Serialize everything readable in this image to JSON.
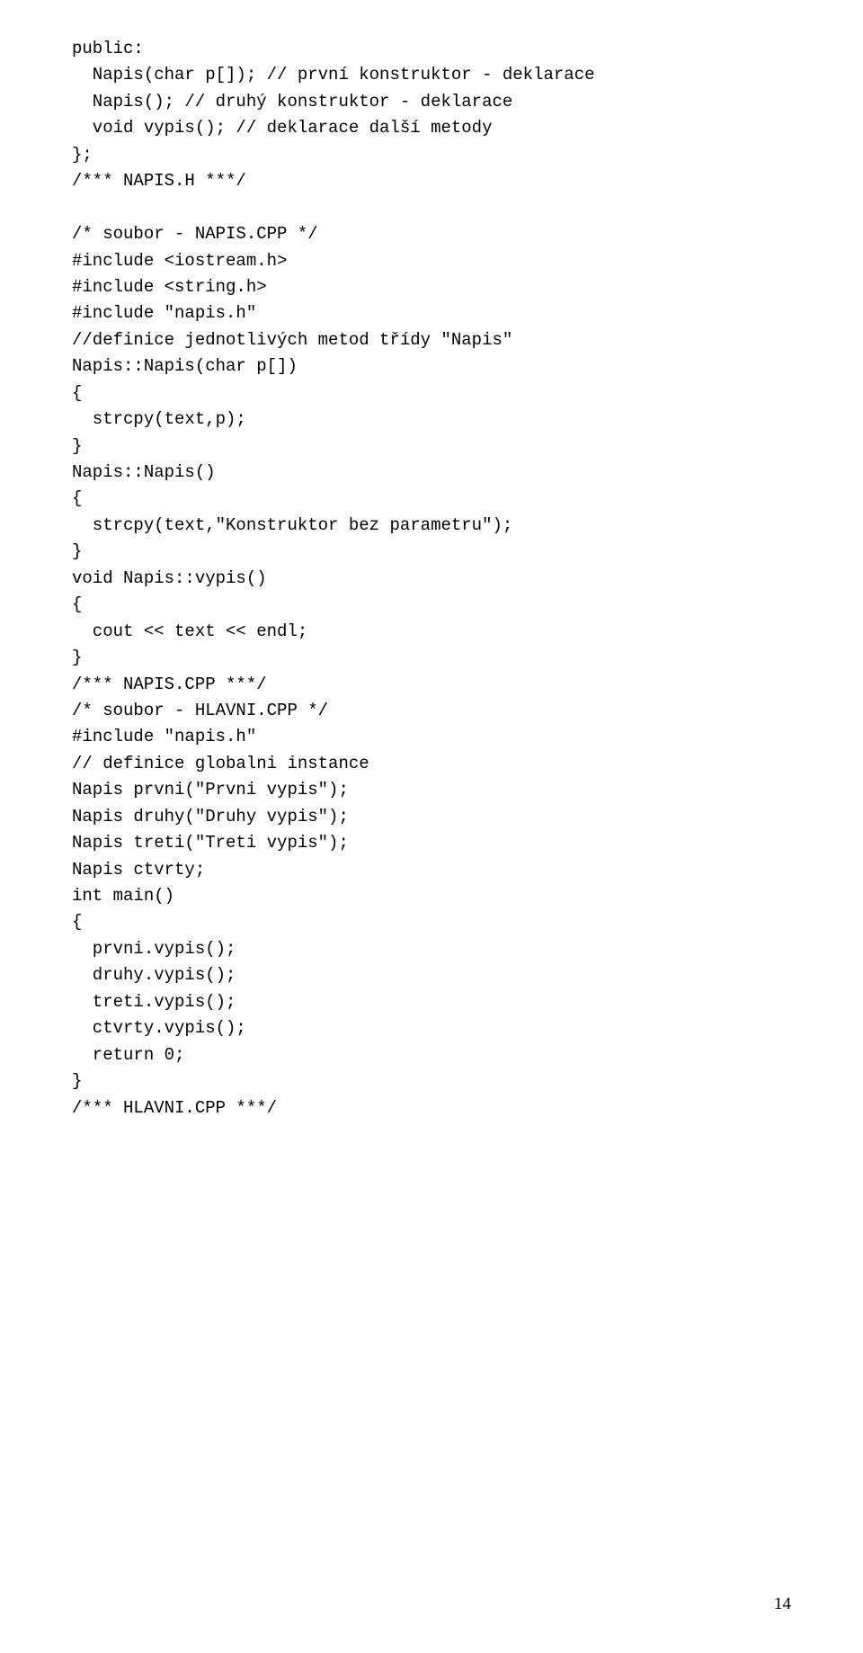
{
  "code": {
    "line1": "public:",
    "line2": "  Napis(char p[]); // první konstruktor - deklarace",
    "line3": "  Napis(); // druhý konstruktor - deklarace",
    "line4": "  void vypis(); // deklarace další metody",
    "line5": "};",
    "line6": "/*** NAPIS.H ***/",
    "line7": "",
    "line8": "/* soubor - NAPIS.CPP */",
    "line9": "#include <iostream.h>",
    "line10": "#include <string.h>",
    "line11": "#include \"napis.h\"",
    "line12": "//definice jednotlivých metod třídy \"Napis\"",
    "line13": "Napis::Napis(char p[])",
    "line14": "{",
    "line15": "  strcpy(text,p);",
    "line16": "}",
    "line17": "Napis::Napis()",
    "line18": "{",
    "line19": "  strcpy(text,\"Konstruktor bez parametru\");",
    "line20": "}",
    "line21": "void Napis::vypis()",
    "line22": "{",
    "line23": "  cout << text << endl;",
    "line24": "}",
    "line25": "/*** NAPIS.CPP ***/",
    "line26": "/* soubor - HLAVNI.CPP */",
    "line27": "#include \"napis.h\"",
    "line28": "// definice globalni instance",
    "line29": "Napis prvni(\"Prvni vypis\");",
    "line30": "Napis druhy(\"Druhy vypis\");",
    "line31": "Napis treti(\"Treti vypis\");",
    "line32": "Napis ctvrty;",
    "line33": "int main()",
    "line34": "{",
    "line35": "  prvni.vypis();",
    "line36": "  druhy.vypis();",
    "line37": "  treti.vypis();",
    "line38": "  ctvrty.vypis();",
    "line39": "  return 0;",
    "line40": "}",
    "line41": "/*** HLAVNI.CPP ***/"
  },
  "page_number": "14"
}
